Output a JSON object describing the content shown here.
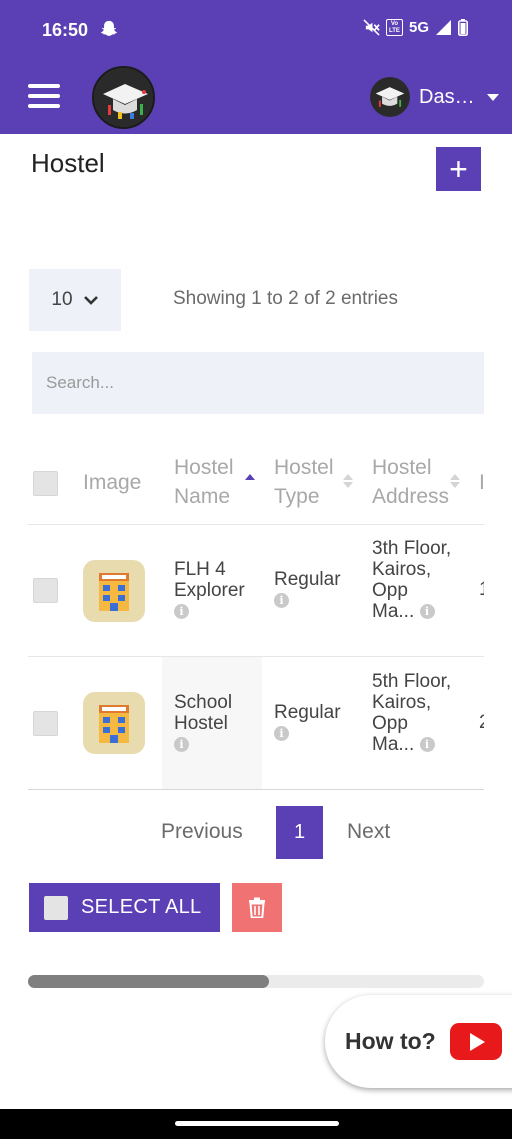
{
  "status_bar": {
    "time": "16:50",
    "network": "5G",
    "volte": "Vo LTE"
  },
  "app_bar": {
    "menu_icon": "hamburger-menu-icon",
    "logo_icon": "graduation-cap-logo",
    "user_name": "Das…",
    "accent_color": "#5b3fb5"
  },
  "page": {
    "title": "Hostel",
    "add_label": "+"
  },
  "controls": {
    "page_length": "10",
    "entries_info": "Showing 1 to 2 of 2 entries",
    "search_placeholder": "Search..."
  },
  "table": {
    "columns": [
      "Image",
      "Hostel Name",
      "Hostel Type",
      "Hostel Address"
    ],
    "sorted_column": "Hostel Name",
    "rows": [
      {
        "name": "FLH 4 Explorer",
        "type": "Regular",
        "address": "3th Floor, Kairos, Opp Ma...",
        "next_col_char": "1"
      },
      {
        "name": "School Hostel",
        "type": "Regular",
        "address": "5th Floor, Kairos, Opp Ma...",
        "next_col_char": "2"
      }
    ]
  },
  "pagination": {
    "previous": "Previous",
    "current": "1",
    "next": "Next"
  },
  "bulk": {
    "select_all": "SELECT ALL",
    "delete_icon": "trash-icon",
    "delete_color": "#f07272"
  },
  "help": {
    "label": "How to?",
    "icon": "youtube-play-icon"
  }
}
